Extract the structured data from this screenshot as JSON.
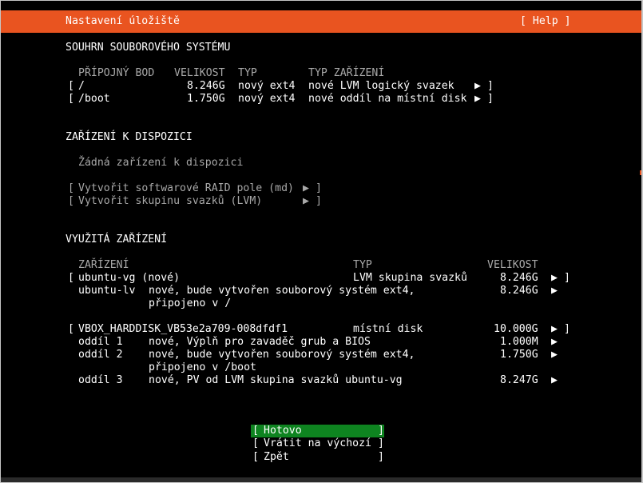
{
  "header": {
    "title": "Nastavení úložiště",
    "help": "[ Help ]"
  },
  "fs_summary": {
    "heading": "SOUHRN SOUBOROVÉHO SYSTÉMU",
    "columns": {
      "mount": "PŘÍPOJNÝ BOD",
      "size": "VELIKOST",
      "type": "TYP",
      "device_type": "TYP ZAŘÍZENÍ"
    },
    "rows": [
      {
        "open": "[",
        "mount": "/",
        "size": "8.246G",
        "type": "nový ext4",
        "device_type": "nové LVM logický svazek",
        "arrow": "▶",
        "close": "]"
      },
      {
        "open": "[",
        "mount": "/boot",
        "size": "1.750G",
        "type": "nový ext4",
        "device_type": "nové oddíl na místní disk",
        "arrow": "▶",
        "close": "]"
      }
    ]
  },
  "available": {
    "heading": "ZAŘÍZENÍ K DISPOZICI",
    "empty": "Žádná zařízení k dispozici",
    "actions": [
      {
        "open": "[",
        "label": "Vytvořit softwarové RAID pole (md)",
        "arrow": "▶",
        "close": "]"
      },
      {
        "open": "[",
        "label": "Vytvořit skupinu svazků (LVM)",
        "arrow": "▶",
        "close": "]"
      }
    ]
  },
  "used": {
    "heading": "VYUŽITÁ ZAŘÍZENÍ",
    "columns": {
      "device": "ZAŘÍZENÍ",
      "type": "TYP",
      "size": "VELIKOST"
    },
    "vg": {
      "open": "[",
      "name": "ubuntu-vg (nové)",
      "type": "LVM skupina svazků",
      "size": "8.246G",
      "arrow": "▶",
      "close": "]"
    },
    "lv": {
      "name": "ubuntu-lv",
      "desc1": "nové, bude vytvořen souborový systém ext4,",
      "desc2": "připojeno v /",
      "size": "8.246G",
      "arrow": "▶"
    },
    "disk": {
      "open": "[",
      "name": "VBOX_HARDDISK_VB53e2a709-008dfdf1",
      "type": "místní disk",
      "size": "10.000G",
      "arrow": "▶",
      "close": "]"
    },
    "partitions": [
      {
        "name": "oddíl 1",
        "desc1": "nové, Výplň pro zavaděč grub a BIOS",
        "desc2": "",
        "size": "1.000M",
        "arrow": "▶"
      },
      {
        "name": "oddíl 2",
        "desc1": "nové, bude vytvořen souborový systém ext4,",
        "desc2": "připojeno v /boot",
        "size": "1.750G",
        "arrow": "▶"
      },
      {
        "name": "oddíl 3",
        "desc1": "nové, PV od LVM skupina svazků ubuntu-vg",
        "desc2": "",
        "size": "8.247G",
        "arrow": "▶"
      }
    ]
  },
  "buttons": {
    "open": "[",
    "close": "]",
    "done": "Hotovo",
    "reset": "Vrátit na výchozí",
    "back": "Zpět"
  },
  "colors": {
    "header": "#e95420",
    "focus": "#0e8420",
    "background": "#000000",
    "text": "#ffffff",
    "dim": "#a8a8a8"
  }
}
